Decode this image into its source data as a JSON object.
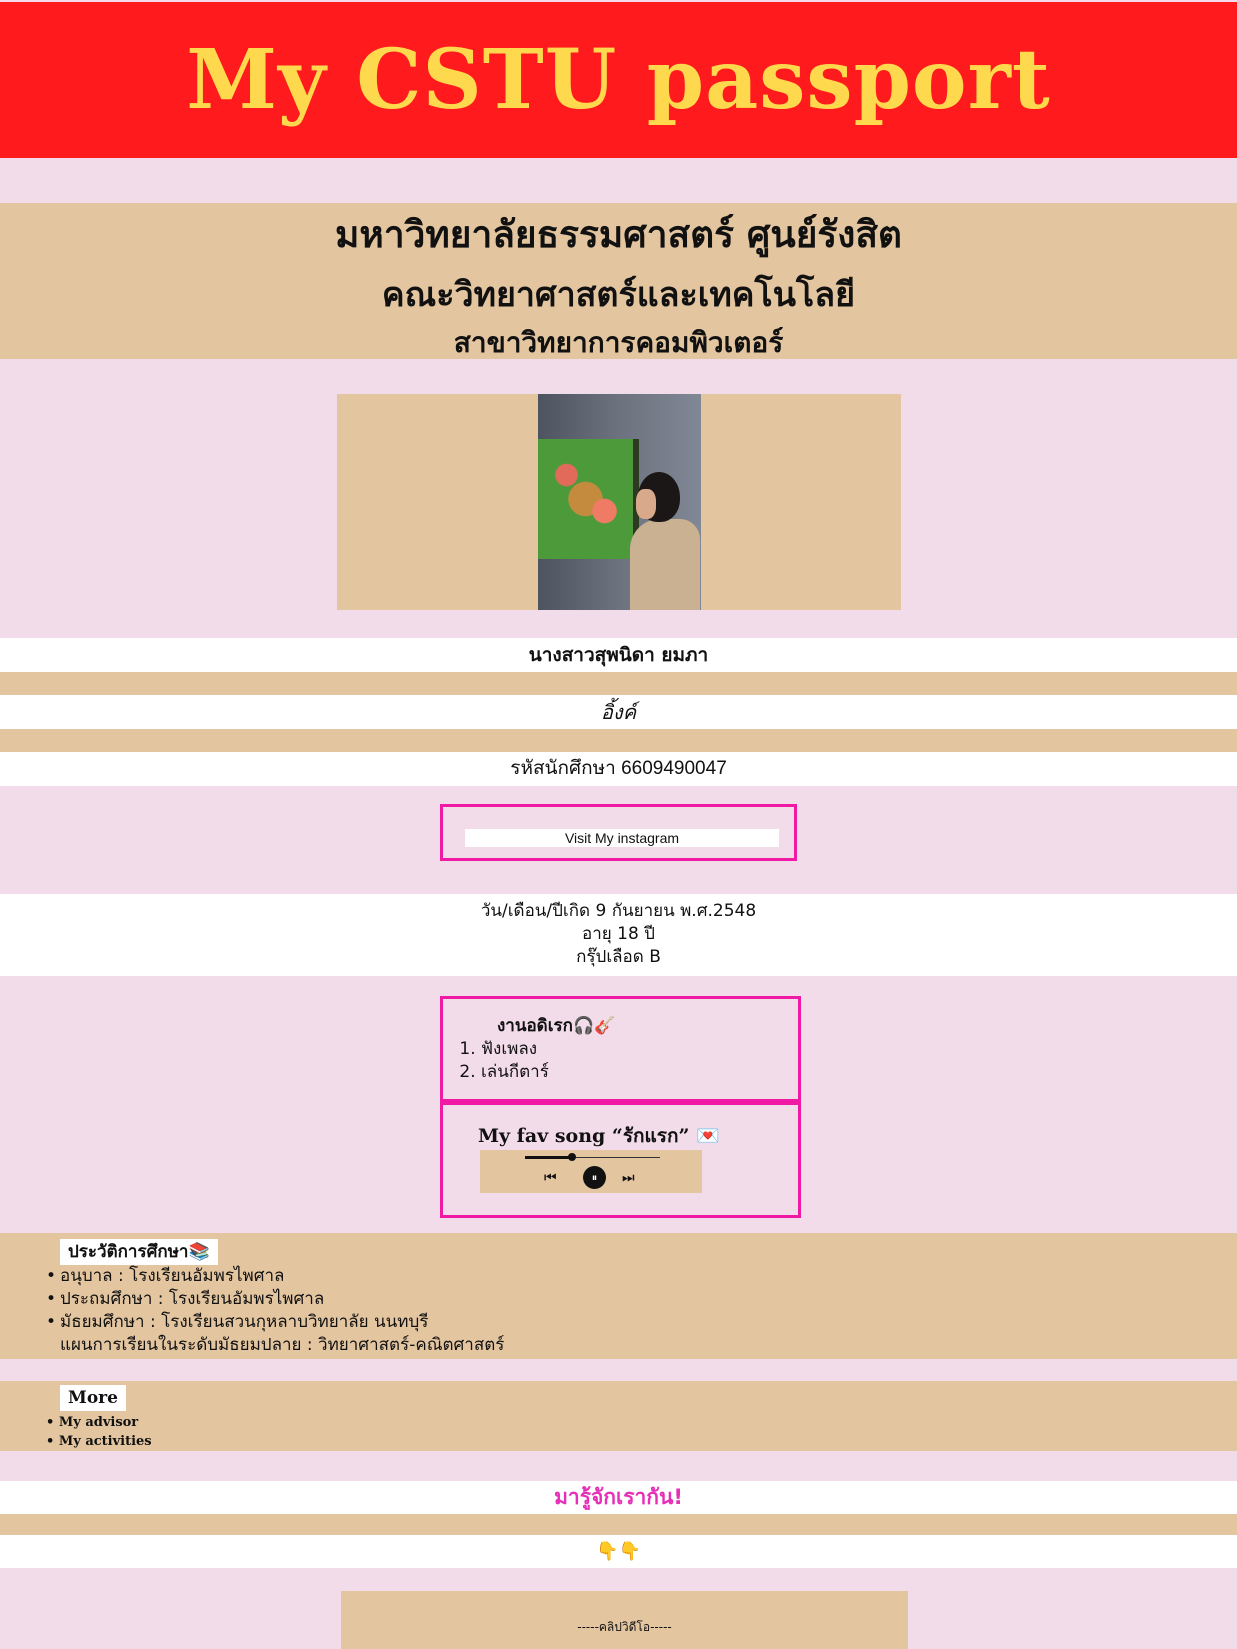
{
  "header": {
    "title": "My CSTU passport",
    "background_color": "#ff1b1d",
    "title_color": "#ffd94d"
  },
  "university": {
    "name": "มหาวิทยาลัยธรรมศาสตร์ ศูนย์รังสิต",
    "faculty": "คณะวิทยาศาสตร์และเทคโนโลยี",
    "department": "สาขาวิทยาการคอมพิวเตอร์"
  },
  "profile": {
    "photo_icon": "profile-photo",
    "full_name": "นางสาวสุพนิดา ยมภา",
    "nickname": "อิ้งค์",
    "student_id": "รหัสนักศึกษา 6609490047",
    "instagram_button": "Visit My instagram",
    "birthdate": "วัน/เดือน/ปีเกิด 9 กันยายน พ.ศ.2548",
    "age": "อายุ 18 ปี",
    "blood_group": "กรุ๊ปเลือด B"
  },
  "hobbies": {
    "title": "งานอดิเรก🎧🎸",
    "items": [
      "ฟังเพลง",
      "เล่นกีตาร์"
    ]
  },
  "song": {
    "title": "My fav song “รักแรก” 💌",
    "progress": 0.35,
    "controls": {
      "prev_icon": "⏮",
      "pause_icon": "⏸",
      "next_icon": "⏭"
    }
  },
  "education": {
    "title": "ประวัติการศึกษา📚",
    "items": [
      "อนุบาล : โรงเรียนอัมพรไพศาล",
      "ประถมศึกษา : โรงเรียนอัมพรไพศาล",
      "มัธยมศึกษา : โรงเรียนสวนกุหลาบวิทยาลัย นนทบุรี"
    ],
    "extra": "แผนการเรียนในระดับมัธยมปลาย : วิทยาศาสตร์-คณิตศาสตร์"
  },
  "more": {
    "title": "More",
    "links": [
      "My advisor",
      "My activities"
    ]
  },
  "footer": {
    "get_to_know": "มารู้จักเรากัน!",
    "pointing_down": "👇👇",
    "video_label": "-----คลิปวิดีโอ-----"
  },
  "colors": {
    "page_bg": "#f3dcea",
    "tan": "#e3c5a0",
    "accent_pink": "#f01aa5",
    "heading_pink": "#e52fb8"
  }
}
